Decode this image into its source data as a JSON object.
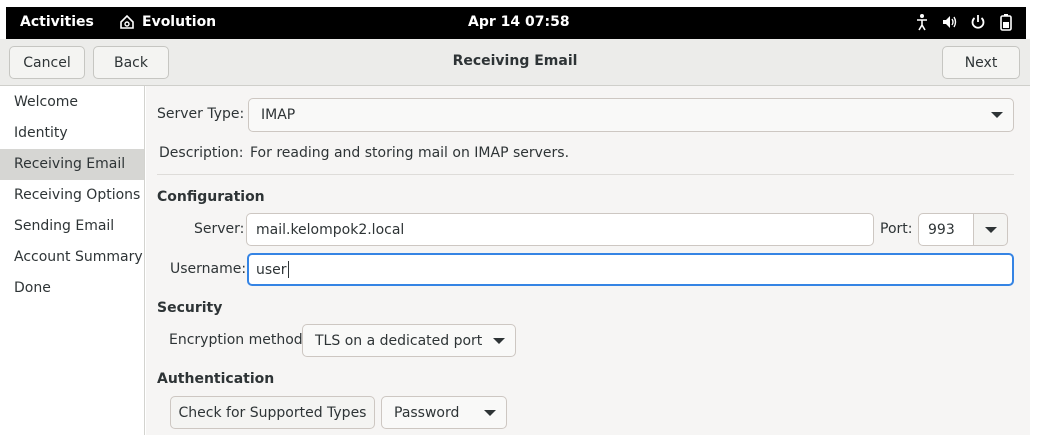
{
  "topbar": {
    "activities": "Activities",
    "app_name": "Evolution",
    "clock": "Apr 14  07:58",
    "tray_icons": [
      "accessibility-icon",
      "volume-icon",
      "power-icon",
      "battery-icon"
    ]
  },
  "header": {
    "cancel_label": "Cancel",
    "back_label": "Back",
    "title": "Receiving Email",
    "next_label": "Next"
  },
  "sidebar": {
    "items": [
      {
        "label": "Welcome"
      },
      {
        "label": "Identity"
      },
      {
        "label": "Receiving Email"
      },
      {
        "label": "Receiving Options"
      },
      {
        "label": "Sending Email"
      },
      {
        "label": "Account Summary"
      },
      {
        "label": "Done"
      }
    ],
    "active_index": 2
  },
  "form": {
    "server_type_label": "Server Type:",
    "server_type_value": "IMAP",
    "description_label": "Description:",
    "description_value": "For reading and storing mail on IMAP servers.",
    "configuration_heading": "Configuration",
    "server_label": "Server:",
    "server_value": "mail.kelompok2.local",
    "port_label": "Port:",
    "port_value": "993",
    "username_label": "Username:",
    "username_value": "user",
    "security_heading": "Security",
    "encryption_label": "Encryption method:",
    "encryption_value": "TLS on a dedicated port",
    "authentication_heading": "Authentication",
    "check_types_label": "Check for Supported Types",
    "auth_value": "Password"
  },
  "colors": {
    "topbar": "#000000",
    "focus_accent": "#3584e4",
    "sidebar_active": "#d6d6d3"
  }
}
